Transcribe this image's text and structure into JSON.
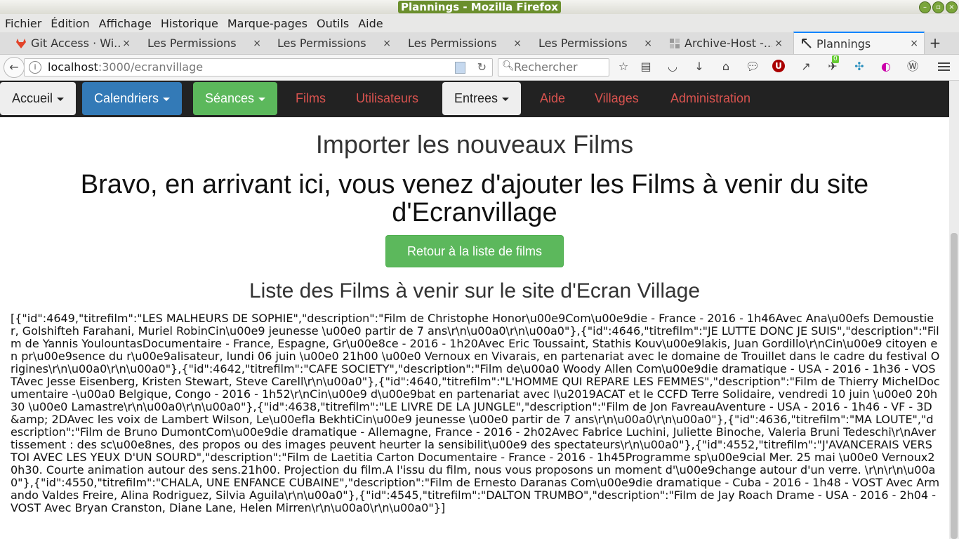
{
  "window": {
    "title": "Plannings - Mozilla Firefox"
  },
  "menubar": [
    "Fichier",
    "Édition",
    "Affichage",
    "Historique",
    "Marque-pages",
    "Outils",
    "Aide"
  ],
  "tabs": [
    {
      "label": "Git Access · Wi...",
      "icon": "gitlab-icon",
      "active": false
    },
    {
      "label": "Les Permissions",
      "active": false
    },
    {
      "label": "Les Permissions",
      "active": false
    },
    {
      "label": "Les Permissions",
      "active": false
    },
    {
      "label": "Les Permissions",
      "active": false
    },
    {
      "label": "Archive-Host -...",
      "icon": "archive-host-icon",
      "active": false
    },
    {
      "label": "Plannings",
      "icon": "plannings-icon",
      "active": true
    }
  ],
  "navbar": {
    "url_host": "localhost",
    "url_rest": ":3000/ecranvillage",
    "search_placeholder": "Rechercher",
    "badge_count": "0"
  },
  "appnav": {
    "dropdowns": {
      "accueil": "Accueil",
      "calendriers": "Calendriers",
      "seances": "Séances",
      "entrees": "Entrees"
    },
    "links": {
      "films": "Films",
      "utilisateurs": "Utilisateurs",
      "aide": "Aide",
      "villages": "Villages",
      "administration": "Administration"
    }
  },
  "main": {
    "import_title": "Importer les nouveaux Films",
    "bravo_title": "Bravo, en arrivant ici, vous venez d'ajouter les Films à venir du site d'Ecranvillage",
    "back_button": "Retour à la liste de films",
    "list_title": "Liste des Films à venir sur le site d'Ecran Village",
    "json_text": "[{\"id\":4649,\"titrefilm\":\"LES MALHEURS DE SOPHIE\",\"description\":\"Film de Christophe Honor\\u00e9Com\\u00e9die - France - 2016 - 1h46Avec Ana\\u00efs Demoustier, Golshifteh Farahani, Muriel RobinCin\\u00e9 jeunesse \\u00e0 partir de 7 ans\\r\\n\\u00a0\\r\\n\\u00a0\"},{\"id\":4646,\"titrefilm\":\"JE LUTTE DONC JE SUIS\",\"description\":\"Film de Yannis YoulountasDocumentaire - France, Espagne, Gr\\u00e8ce - 2016 - 1h20Avec Eric Toussaint, Stathis Kouv\\u00e9lakis, Juan Gordillo\\r\\nCin\\u00e9 citoyen en pr\\u00e9sence du r\\u00e9alisateur, lundi 06 juin \\u00e0 21h00 \\u00e0 Vernoux en Vivarais, en partenariat avec le domaine de Trouillet dans le cadre du festival Origines\\r\\n\\u00a0\\r\\n\\u00a0\"},{\"id\":4642,\"titrefilm\":\"CAFE SOCIETY\",\"description\":\"Film de\\u00a0 Woody Allen Com\\u00e9die dramatique - USA - 2016 - 1h36 - VOSTAvec Jesse Eisenberg, Kristen Stewart, Steve Carell\\r\\n\\u00a0\"},{\"id\":4640,\"titrefilm\":\"L'HOMME QUI REPARE LES FEMMES\",\"description\":\"Film de Thierry MichelDocumentaire -\\u00a0 Belgique, Congo - 2016 - 1h52\\r\\nCin\\u00e9 d\\u00e9bat en partenariat avec l\\u2019ACAT et le CCFD Terre Solidaire, vendredi 10 juin \\u00e0 20h30 \\u00e0 Lamastre\\r\\n\\u00a0\\r\\n\\u00a0\"},{\"id\":4638,\"titrefilm\":\"LE LIVRE DE LA JUNGLE\",\"description\":\"Film de Jon FavreauAventure - USA - 2016 - 1h46 - VF - 3D &amp; 2DAvec les voix de Lambert Wilson, Le\\u00efla BekhtiCin\\u00e9 jeunesse \\u00e0 partir de 7 ans\\r\\n\\u00a0\\r\\n\\u00a0\"},{\"id\":4636,\"titrefilm\":\"MA LOUTE\",\"description\":\"Film de Bruno DumontCom\\u00e9die dramatique - Allemagne, France - 2016 - 2h02Avec Fabrice Luchini, Juliette Binoche, Valeria Bruni Tedeschi\\r\\nAvertissement : des sc\\u00e8nes, des propos ou des images peuvent heurter la sensibilit\\u00e9 des spectateurs\\r\\n\\u00a0\"},{\"id\":4552,\"titrefilm\":\"J'AVANCERAIS VERS TOI AVEC LES YEUX D'UN SOURD\",\"description\":\"Film de Laetitia Carton Documentaire - France - 2016 - 1h45Programme sp\\u00e9cial Mer. 25 mai \\u00e0 Vernoux20h30. Courte animation autour des sens.21h00. Projection du film.A l'issu du film, nous vous proposons un moment d'\\u00e9change autour d'un verre. \\r\\n\\r\\n\\u00a0\"},{\"id\":4550,\"titrefilm\":\"CHALA, UNE ENFANCE CUBAINE\",\"description\":\"Film de Ernesto Daranas Com\\u00e9die dramatique - Cuba - 2016 - 1h48 - VOST Avec Armando Valdes Freire, Alina Rodriguez, Silvia Aguila\\r\\n\\u00a0\"},{\"id\":4545,\"titrefilm\":\"DALTON TRUMBO\",\"description\":\"Film de Jay Roach Drame - USA - 2016 - 2h04 - VOST Avec Bryan Cranston, Diane Lane, Helen Mirren\\r\\n\\u00a0\\r\\n\\u00a0\"}]"
  },
  "colors": {
    "accent_tab": "#0a84ff",
    "navbar_bg": "#222222",
    "link_red": "#d9534f",
    "blue": "#337ab7",
    "green": "#5cb85c"
  }
}
